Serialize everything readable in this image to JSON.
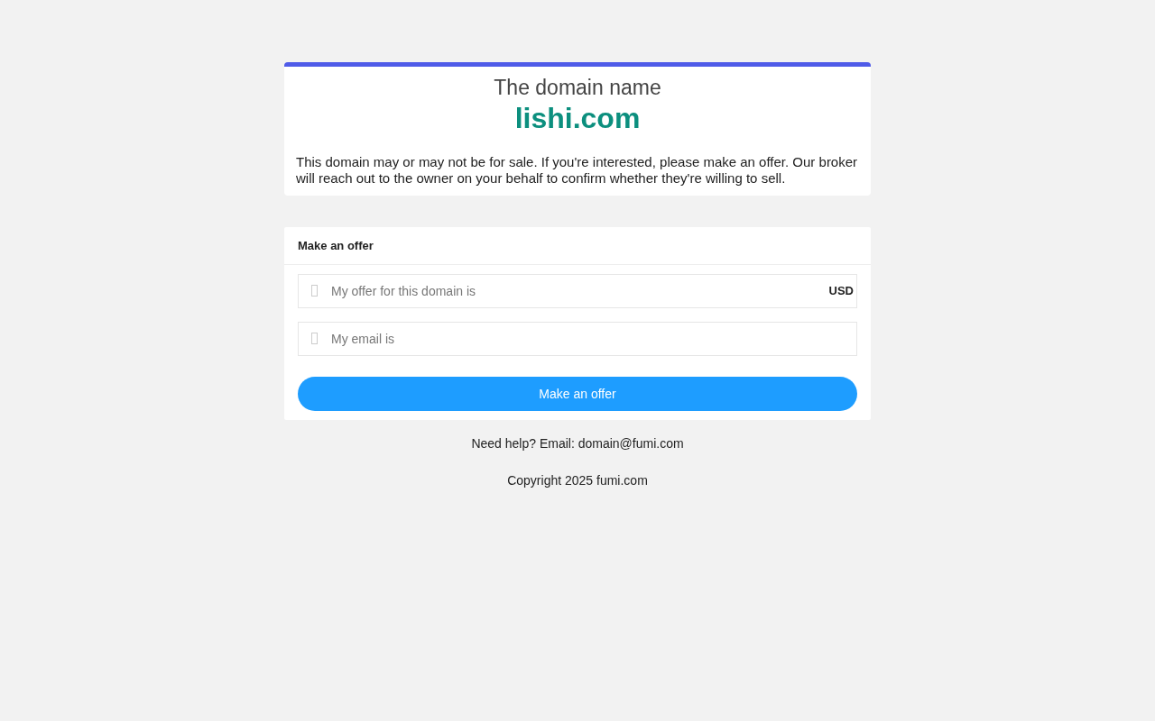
{
  "header": {
    "title": "The domain name",
    "domain": "lishi.com",
    "description": "This domain may or may not be for sale. If you're interested, please make an offer. Our broker will reach out to the owner on your behalf to confirm whether they're willing to sell."
  },
  "offer_form": {
    "title": "Make an offer",
    "fields": [
      {
        "placeholder": "My offer for this domain is",
        "suffix": "USD"
      },
      {
        "placeholder": "My email is"
      }
    ],
    "button": "Make an offer"
  },
  "footer": {
    "help": "Need help? Email: domain@fumi.com",
    "copyright": "Copyright 2025 fumi.com"
  }
}
